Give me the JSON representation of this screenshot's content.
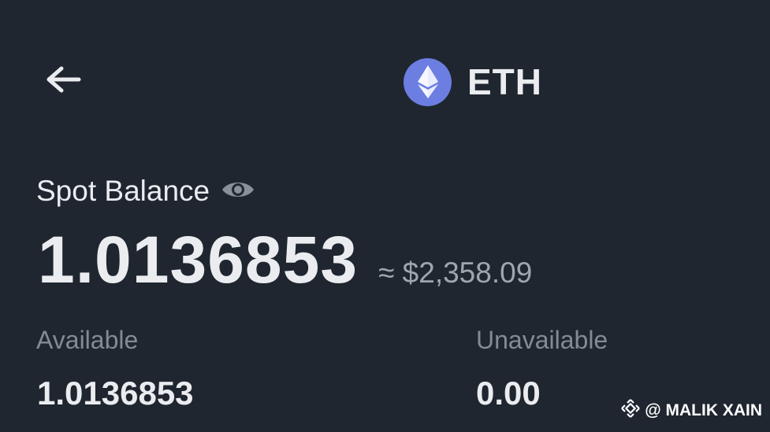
{
  "header": {
    "coin_symbol": "ETH",
    "coin_icon": "ethereum-icon",
    "back_icon": "arrow-left-icon",
    "coin_color": "#6c7ee1"
  },
  "balance": {
    "label": "Spot Balance",
    "visibility_icon": "eye-icon",
    "amount": "1.0136853",
    "fiat_equivalent": "≈ $2,358.09"
  },
  "available": {
    "label": "Available",
    "value": "1.0136853"
  },
  "unavailable": {
    "label": "Unavailable",
    "value": "0.00"
  },
  "watermark": {
    "icon": "binance-diamond-icon",
    "text": "@ MALIK XAIN"
  },
  "colors": {
    "background": "#1f2630",
    "primary_text": "#eaecef",
    "secondary_text": "#858b95"
  }
}
